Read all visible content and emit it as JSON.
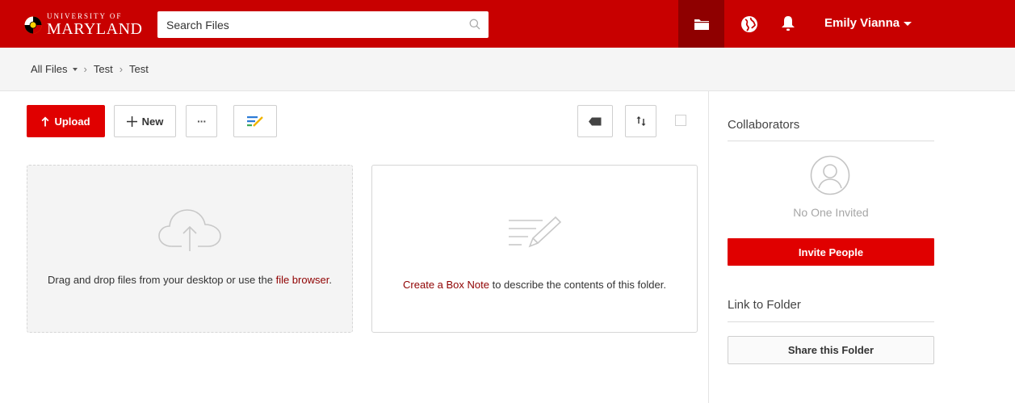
{
  "header": {
    "logo": {
      "line1": "UNIVERSITY OF",
      "line2": "MARYLAND"
    },
    "search": {
      "placeholder": "Search Files",
      "value": ""
    },
    "user_name": "Emily Vianna",
    "icons": [
      "search-icon",
      "folder-icon",
      "globe-icon",
      "bell-icon",
      "chevron-down-icon"
    ]
  },
  "breadcrumb": {
    "root": "All Files",
    "items": [
      "Test",
      "Test"
    ],
    "separator": "›"
  },
  "toolbar": {
    "upload_label": "Upload",
    "new_label": "New",
    "more_label": "···",
    "icons": [
      "arrow-up-icon",
      "plus-icon",
      "box-note-icon",
      "tag-icon",
      "sort-icon"
    ]
  },
  "dropzone": {
    "text_before": "Drag and drop files from your desktop or use the ",
    "link": "file browser",
    "text_after": "."
  },
  "note_card": {
    "link": "Create a Box Note",
    "text_after": " to describe the contents of this folder."
  },
  "sidebar": {
    "collaborators_heading": "Collaborators",
    "no_one_invited": "No One Invited",
    "invite_label": "Invite People",
    "link_heading": "Link to Folder",
    "share_label": "Share this Folder"
  },
  "colors": {
    "brand_red": "#c80000",
    "button_red": "#e00000",
    "dark_red": "#8f0000",
    "link": "#8f0000"
  }
}
